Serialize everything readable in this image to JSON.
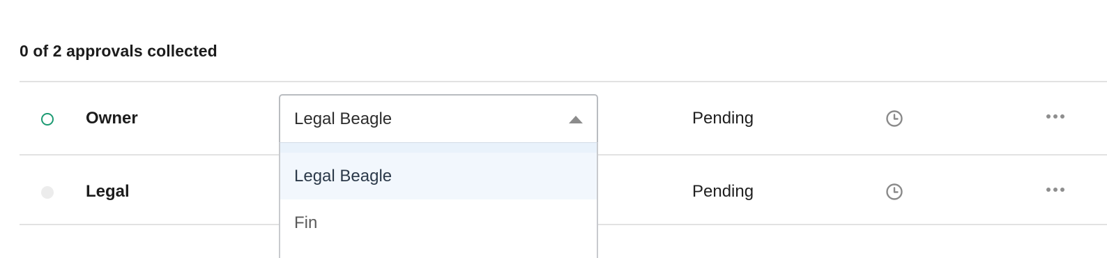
{
  "summary": "0 of 2 approvals collected",
  "colors": {
    "accent_green": "#1c9a72",
    "muted_dot": "#ececec",
    "divider": "#e2e2e2",
    "highlight": "#f2f7fd"
  },
  "rows": [
    {
      "role": "Owner",
      "status_indicator": "open",
      "assignee": "Legal Beagle",
      "status": "Pending",
      "time_icon": "clock-icon",
      "menu_icon": "more-icon"
    },
    {
      "role": "Legal",
      "status_indicator": "muted",
      "status": "Pending",
      "time_icon": "clock-icon",
      "menu_icon": "more-icon"
    }
  ],
  "dropdown": {
    "selected": "Legal Beagle",
    "open": true,
    "caret_icon": "caret-up-icon",
    "options": [
      {
        "label": "Legal Beagle",
        "highlighted": true
      },
      {
        "label": "Fin",
        "highlighted": false
      }
    ]
  }
}
